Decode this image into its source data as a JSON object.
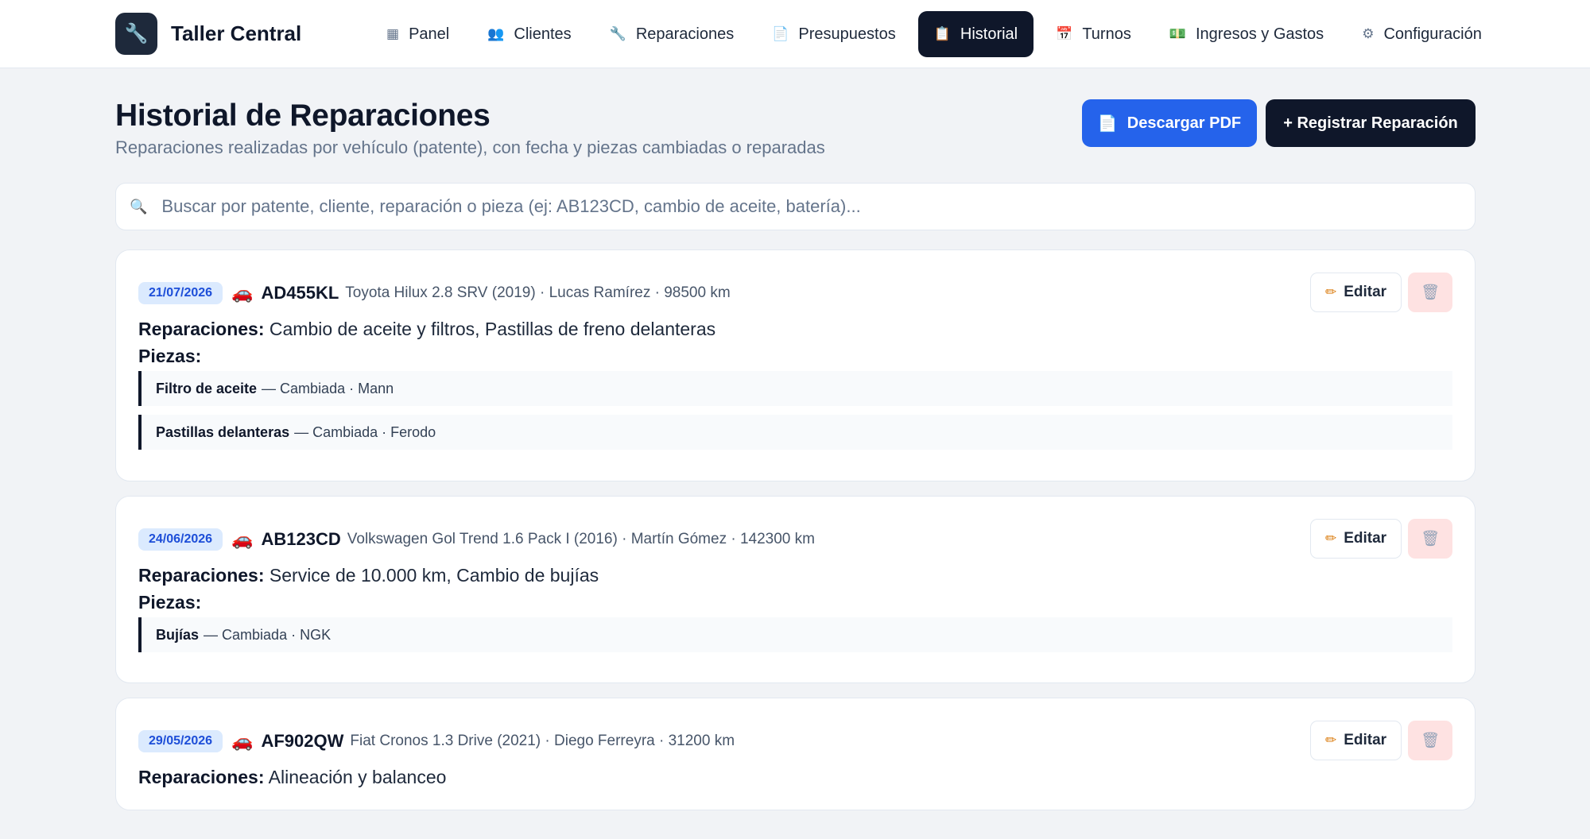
{
  "brand": {
    "name": "Taller Central",
    "logo_icon": "wrench-icon"
  },
  "nav": [
    {
      "label": "Panel",
      "icon": "chart-icon",
      "glyph": "▦"
    },
    {
      "label": "Clientes",
      "icon": "users-icon",
      "glyph": "👥"
    },
    {
      "label": "Reparaciones",
      "icon": "wrench-icon",
      "glyph": "🔧"
    },
    {
      "label": "Presupuestos",
      "icon": "document-icon",
      "glyph": "📄"
    },
    {
      "label": "Historial",
      "icon": "clipboard-icon",
      "glyph": "📋",
      "active": true
    },
    {
      "label": "Turnos",
      "icon": "calendar-icon",
      "glyph": "📅"
    },
    {
      "label": "Ingresos y Gastos",
      "icon": "money-icon",
      "glyph": "💵"
    },
    {
      "label": "Configuración",
      "icon": "gear-icon",
      "glyph": "⚙"
    }
  ],
  "header": {
    "title": "Historial de Reparaciones",
    "subtitle": "Reparaciones realizadas por vehículo (patente), con fecha y piezas cambiadas o reparadas",
    "pdf_button": "Descargar PDF",
    "add_button": "+ Registrar Reparación"
  },
  "search": {
    "placeholder": "Buscar por patente, cliente, reparación o pieza (ej: AB123CD, cambio de aceite, batería)...",
    "value": ""
  },
  "labels": {
    "repairs": "Reparaciones:",
    "parts": "Piezas:",
    "edit": "Editar"
  },
  "records": [
    {
      "date": "21/07/2026",
      "plate": "AD455KL",
      "meta": "Toyota Hilux 2.8 SRV (2019) · Lucas Ramírez · 98500 km",
      "repairs": "Cambio de aceite y filtros, Pastillas de freno delanteras",
      "parts": [
        {
          "name": "Filtro de aceite",
          "detail": "— Cambiada · Mann"
        },
        {
          "name": "Pastillas delanteras",
          "detail": "— Cambiada · Ferodo"
        }
      ]
    },
    {
      "date": "24/06/2026",
      "plate": "AB123CD",
      "meta": "Volkswagen Gol Trend 1.6 Pack I (2016) · Martín Gómez · 142300 km",
      "repairs": "Service de 10.000 km, Cambio de bujías",
      "parts": [
        {
          "name": "Bujías",
          "detail": "— Cambiada · NGK"
        }
      ]
    },
    {
      "date": "29/05/2026",
      "plate": "AF902QW",
      "meta": "Fiat Cronos 1.3 Drive (2021) · Diego Ferreyra · 31200 km",
      "repairs": "Alineación y balanceo",
      "parts": []
    }
  ],
  "colors": {
    "primary": "#2563eb",
    "dark": "#0f172a",
    "badge_bg": "#dbeafe",
    "delete_bg": "#fee2e2"
  }
}
